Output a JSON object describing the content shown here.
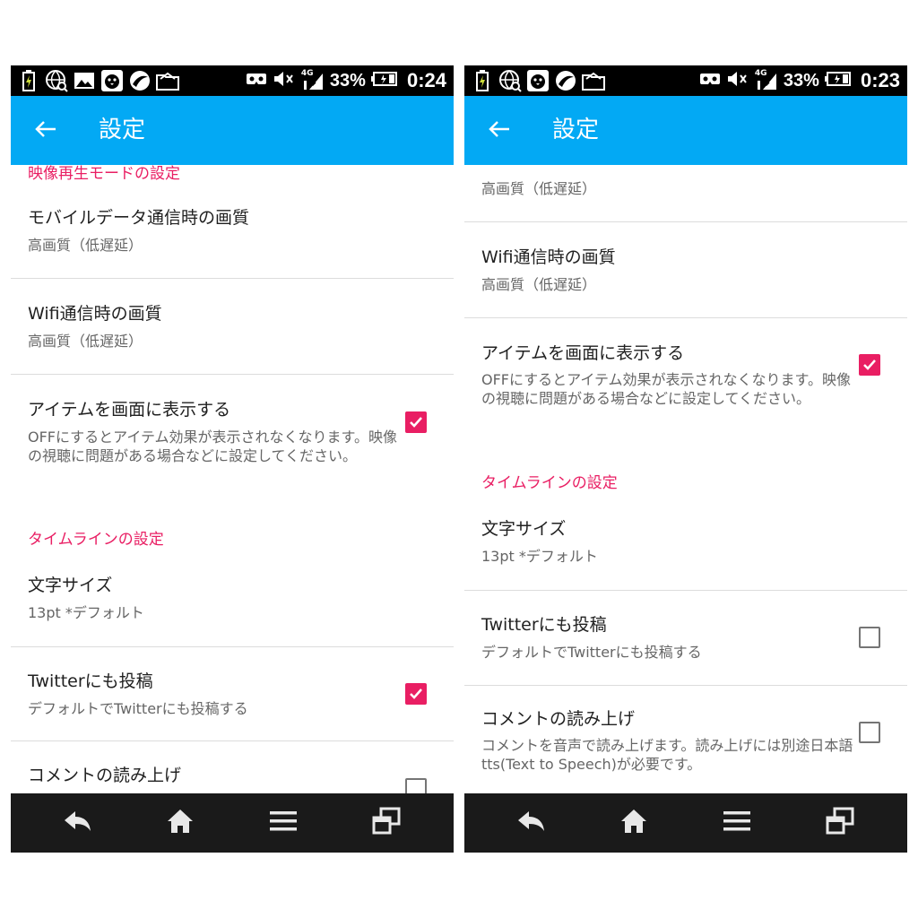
{
  "colors": {
    "accent": "#e91e63",
    "appbar": "#03a9f4",
    "status_bar": "#000000",
    "nav_bar": "#1a1a1a"
  },
  "screens": [
    {
      "status": {
        "battery": "33%",
        "time": "0:24",
        "network": "4G"
      },
      "appbar": {
        "title": "設定",
        "back_icon": "arrow-left-icon"
      },
      "items": {
        "sec_video": "映像再生モードの設定",
        "mobile_title": "モバイルデータ通信時の画質",
        "mobile_value": "高画質（低遅延）",
        "wifi_title": "Wifi通信時の画質",
        "wifi_value": "高画質（低遅延）",
        "item_display_title": "アイテムを画面に表示する",
        "item_display_desc": "OFFにするとアイテム効果が表示されなくなります。映像の視聴に問題がある場合などに設定してください。",
        "sec_timeline": "タイムラインの設定",
        "font_title": "文字サイズ",
        "font_value": "13pt *デフォルト",
        "twitter_title": "Twitterにも投稿",
        "twitter_desc": "デフォルトでTwitterにも投稿する",
        "readout_title": "コメントの読み上げ"
      },
      "checkboxes": {
        "item_display": true,
        "twitter": true,
        "readout": false
      }
    },
    {
      "status": {
        "battery": "33%",
        "time": "0:23",
        "network": "4G"
      },
      "appbar": {
        "title": "設定",
        "back_icon": "arrow-left-icon"
      },
      "items": {
        "mobile_value": "高画質（低遅延）",
        "wifi_title": "Wifi通信時の画質",
        "wifi_value": "高画質（低遅延）",
        "item_display_title": "アイテムを画面に表示する",
        "item_display_desc": "OFFにするとアイテム効果が表示されなくなります。映像の視聴に問題がある場合などに設定してください。",
        "sec_timeline": "タイムラインの設定",
        "font_title": "文字サイズ",
        "font_value": "13pt *デフォルト",
        "twitter_title": "Twitterにも投稿",
        "twitter_desc": "デフォルトでTwitterにも投稿する",
        "readout_title": "コメントの読み上げ",
        "readout_desc": "コメントを音声で読み上げます。読み上げには別途日本語tts(Text to Speech)が必要です。"
      },
      "checkboxes": {
        "item_display": true,
        "twitter": false,
        "readout": false
      }
    }
  ],
  "navbar": {
    "icons": [
      "back-arrow-icon",
      "home-icon",
      "menu-icon",
      "recent-apps-icon"
    ]
  }
}
